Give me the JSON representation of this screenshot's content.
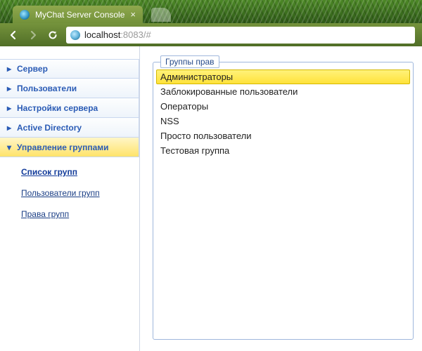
{
  "browser": {
    "tab_title": "MyChat Server Console",
    "url_host": "localhost",
    "url_rest": ":8083/#"
  },
  "sidebar": {
    "items": [
      {
        "label": "Сервер",
        "expanded": false
      },
      {
        "label": "Пользователи",
        "expanded": false
      },
      {
        "label": "Настройки сервера",
        "expanded": false
      },
      {
        "label": "Active Directory",
        "expanded": false
      },
      {
        "label": "Управление группами",
        "expanded": true
      }
    ],
    "subnav": [
      {
        "label": "Список групп",
        "current": true
      },
      {
        "label": "Пользователи групп",
        "current": false
      },
      {
        "label": "Права групп",
        "current": false
      }
    ]
  },
  "groupbox": {
    "legend": "Группы прав",
    "items": [
      {
        "label": "Администраторы",
        "selected": true
      },
      {
        "label": "Заблокированные пользователи",
        "selected": false
      },
      {
        "label": "Операторы",
        "selected": false
      },
      {
        "label": "NSS",
        "selected": false
      },
      {
        "label": "Просто пользователи",
        "selected": false
      },
      {
        "label": "Тестовая группа",
        "selected": false
      }
    ]
  }
}
